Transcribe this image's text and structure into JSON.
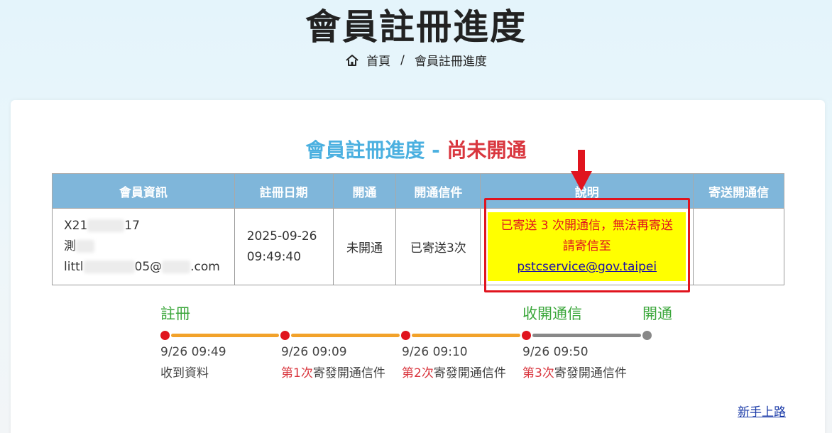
{
  "header": {
    "title": "會員註冊進度",
    "breadcrumb": {
      "home": "首頁",
      "separator": "/",
      "current": "會員註冊進度"
    }
  },
  "status": {
    "prefix": "會員註冊進度 - ",
    "state": "尚未開通"
  },
  "table": {
    "columns": [
      "會員資訊",
      "註冊日期",
      "開通",
      "開通信件",
      "說明",
      "寄送開通信"
    ],
    "row": {
      "member_id_prefix": "X21",
      "member_id_suffix": "17",
      "member_name_prefix": "測",
      "member_email_prefix": "littl",
      "member_email_mid": "05@",
      "member_email_suffix": ".com",
      "reg_date": "2025-09-26",
      "reg_time": "09:49:40",
      "activated": "未開通",
      "mail_status": "已寄送3次",
      "note_line1": "已寄送 3 次開通信，無法再寄送",
      "note_line2": "請寄信至",
      "note_email": "pstcservice@gov.taipei",
      "send_action": ""
    }
  },
  "timeline": {
    "steps": {
      "register": "註冊",
      "receive": "收開通信",
      "activate": "開通"
    },
    "events": [
      {
        "time": "9/26 09:49",
        "desc": "收到資料",
        "nth": ""
      },
      {
        "time": "9/26 09:09",
        "nth": "第1次",
        "desc": "寄發開通信件"
      },
      {
        "time": "9/26 09:10",
        "nth": "第2次",
        "desc": "寄發開通信件"
      },
      {
        "time": "9/26 09:50",
        "nth": "第3次",
        "desc": "寄發開通信件"
      }
    ]
  },
  "footer": {
    "newbie_link": "新手上路"
  },
  "colors": {
    "accent_blue": "#4bb0e0",
    "alert_red": "#d9363e",
    "step_green": "#3ba73b",
    "timeline_orange": "#f2a22a",
    "header_blue": "#7fb6da"
  }
}
